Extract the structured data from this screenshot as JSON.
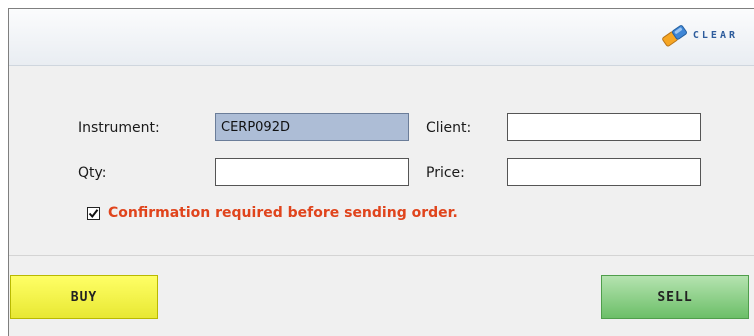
{
  "toolbar": {
    "clear_label": "CLEAR"
  },
  "form": {
    "instrument_label": "Instrument:",
    "instrument_value": "CERP092D",
    "client_label": "Client:",
    "client_value": "",
    "qty_label": "Qty:",
    "qty_value": "",
    "price_label": "Price:",
    "price_value": ""
  },
  "confirmation": {
    "checked": true,
    "text": "Confirmation required before sending order.",
    "color": "#e0441c"
  },
  "actions": {
    "buy_label": "BUY",
    "sell_label": "SELL",
    "buy_color": "#ffff66",
    "sell_color": "#8fd18b"
  },
  "icons": {
    "clear": "eraser-icon",
    "check": "checkmark-icon"
  }
}
